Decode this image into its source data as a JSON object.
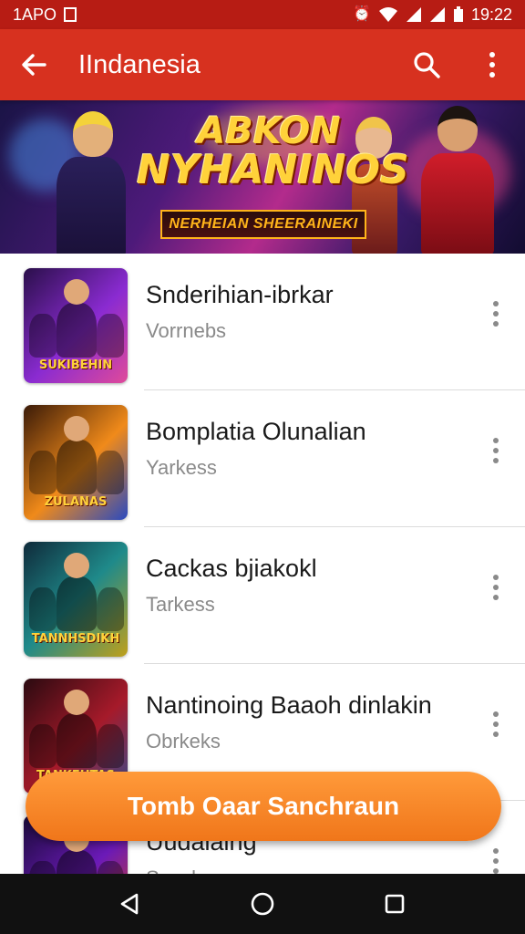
{
  "status_bar": {
    "carrier": "1APO",
    "time": "19:22",
    "icons": [
      "sim-icon",
      "alarm-icon",
      "wifi-icon",
      "signal-icon",
      "signal-icon",
      "battery-icon"
    ]
  },
  "app_bar": {
    "title": "IIndanesia",
    "icons": [
      "back-arrow-icon",
      "search-icon",
      "more-vert-icon"
    ]
  },
  "banner": {
    "title_line1": "ABKON",
    "title_line2": "NYHANINOS",
    "subtitle": "NERHEIAN SHEERAINEKI"
  },
  "list": {
    "items": [
      {
        "title": "Snderihian-ibrkar",
        "subtitle": "Vorrnebs",
        "thumb_caption": "SUKIBEHIN",
        "accent": "#8a2bd1"
      },
      {
        "title": "Bomplatia Olunalian",
        "subtitle": "Yarkess",
        "thumb_caption": "ZULANAS",
        "accent": "#f08a1a"
      },
      {
        "title": "Cackas bjiakokl",
        "subtitle": "Tarkess",
        "thumb_caption": "TANNHSDIKH",
        "accent": "#1f8a8a"
      },
      {
        "title": "Nantinoing Baaoh dinlakin",
        "subtitle": "Obrkeks",
        "thumb_caption": "TANKEHTAS",
        "accent": "#a61a2a"
      },
      {
        "title": "Uudaiaing",
        "subtitle": "Saasksa",
        "thumb_caption": "",
        "accent": "#6b1ab8"
      }
    ]
  },
  "fab": {
    "label": "Tomb Oaar Sanchraun"
  },
  "nav_bar": {
    "icons": [
      "nav-back-icon",
      "nav-home-icon",
      "nav-recents-icon"
    ]
  }
}
